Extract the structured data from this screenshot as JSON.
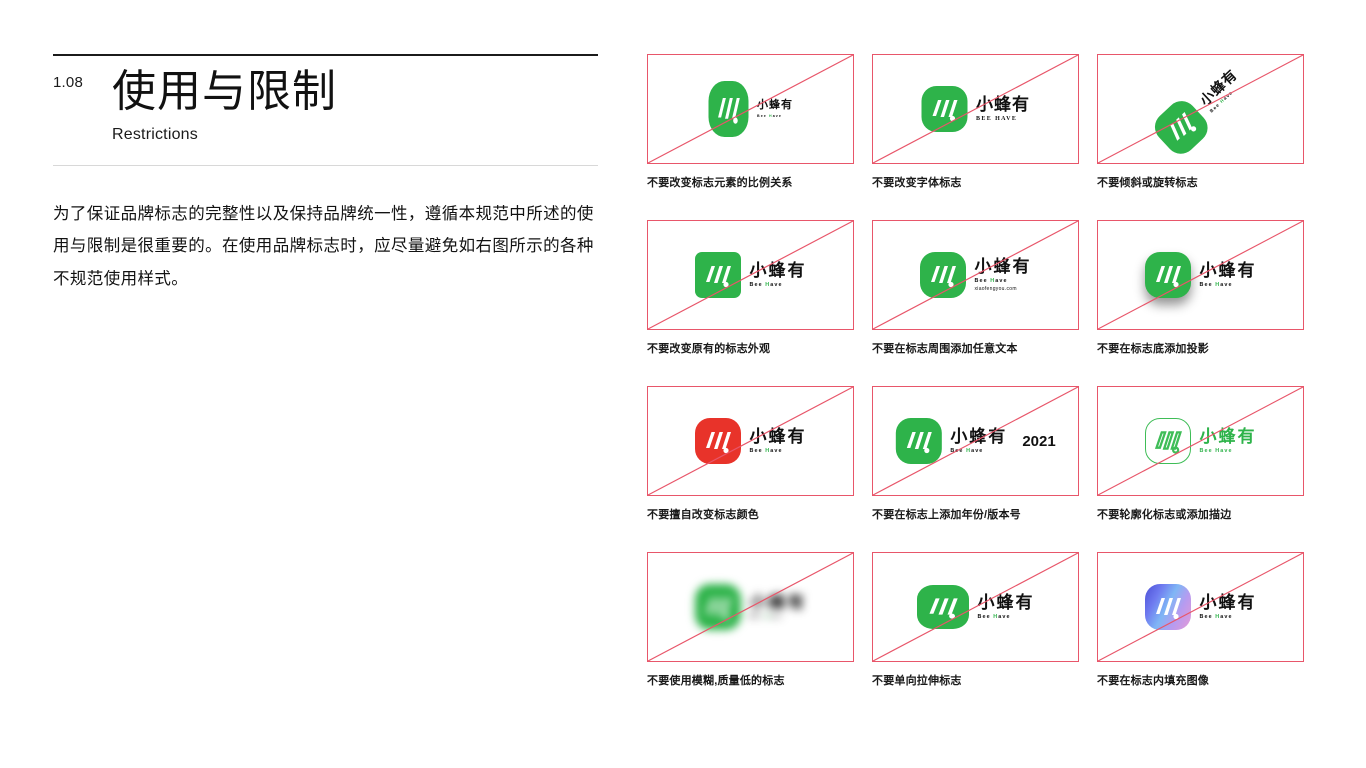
{
  "left": {
    "section_number": "1.08",
    "title_cn": "使用与限制",
    "title_en": "Restrictions",
    "body": "为了保证品牌标志的完整性以及保持品牌统一性，遵循本规范中所述的使用与限制是很重要的。在使用品牌标志时，应尽量避免如右图所示的各种不规范使用样式。"
  },
  "brand": {
    "wordmark_cn": "小蜂有",
    "tagline_prefix": "Bee ",
    "tagline_highlight": "H",
    "tagline_suffix": "ave",
    "tagline_upper": "BEE HAVE",
    "url": "xiaofengyou.com",
    "year": "2021",
    "green": "#2eb34a",
    "red": "#e8332a",
    "slash_red": "#e8566a"
  },
  "cards": [
    {
      "id": "proportion",
      "caption": "不要改变标志元素的比例关系"
    },
    {
      "id": "typeface",
      "caption": "不要改变字体标志"
    },
    {
      "id": "rotate",
      "caption": "不要倾斜或旋转标志"
    },
    {
      "id": "shape",
      "caption": "不要改变原有的标志外观"
    },
    {
      "id": "extra-text",
      "caption": "不要在标志周围添加任意文本"
    },
    {
      "id": "shadow",
      "caption": "不要在标志底添加投影"
    },
    {
      "id": "color",
      "caption": "不要擅自改变标志颜色"
    },
    {
      "id": "year",
      "caption": "不要在标志上添加年份/版本号"
    },
    {
      "id": "outline",
      "caption": "不要轮廓化标志或添加描边"
    },
    {
      "id": "blur",
      "caption": "不要使用模糊,质量低的标志"
    },
    {
      "id": "stretch",
      "caption": "不要单向拉伸标志"
    },
    {
      "id": "image-fill",
      "caption": "不要在标志内填充图像"
    }
  ]
}
